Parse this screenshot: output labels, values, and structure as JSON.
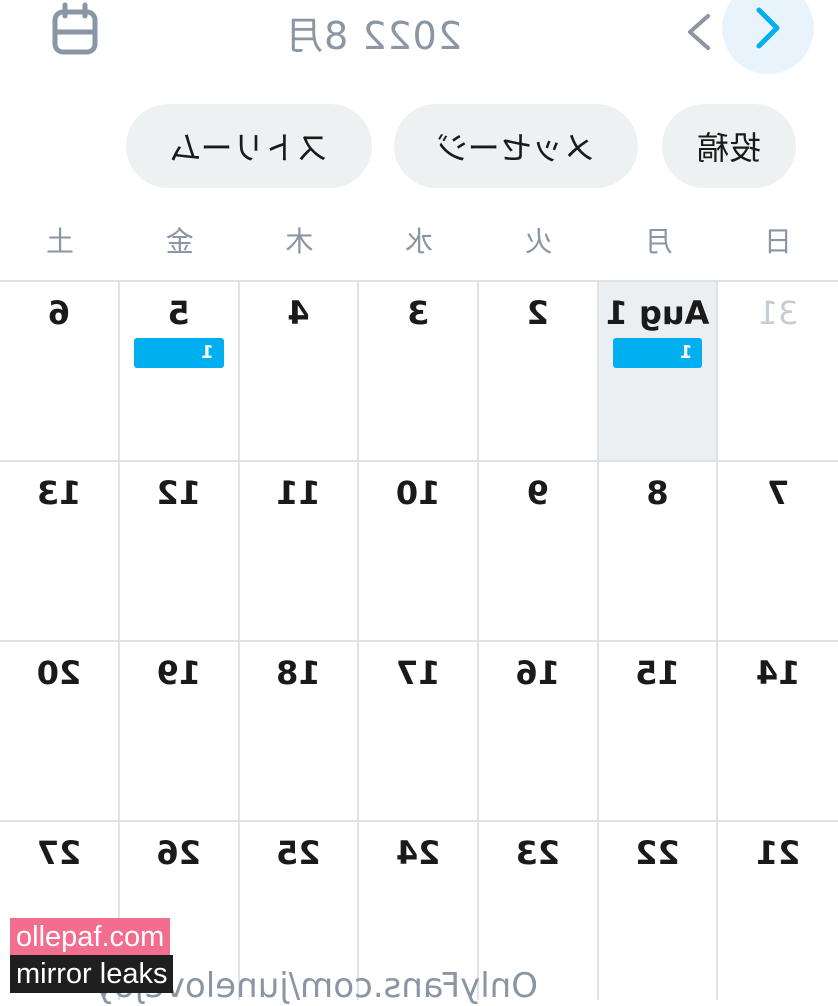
{
  "header": {
    "title": "2022 8月",
    "prev_icon": "chevron-left-icon",
    "next_icon": "chevron-right-icon",
    "calendar_icon": "calendar-icon",
    "accent_color": "#00aff0"
  },
  "chips": {
    "posts": "投稿",
    "messages": "メッセージ",
    "streams": "ストリーム"
  },
  "weekdays": [
    "日",
    "月",
    "火",
    "水",
    "木",
    "金",
    "土"
  ],
  "weeks": [
    [
      {
        "label": "31",
        "muted": true
      },
      {
        "label": "Aug 1",
        "today": true,
        "badge": "1"
      },
      {
        "label": "2"
      },
      {
        "label": "3"
      },
      {
        "label": "4"
      },
      {
        "label": "5",
        "badge": "1"
      },
      {
        "label": "6"
      }
    ],
    [
      {
        "label": "7"
      },
      {
        "label": "8"
      },
      {
        "label": "9"
      },
      {
        "label": "10"
      },
      {
        "label": "11"
      },
      {
        "label": "12"
      },
      {
        "label": "13"
      }
    ],
    [
      {
        "label": "14"
      },
      {
        "label": "15"
      },
      {
        "label": "16"
      },
      {
        "label": "17"
      },
      {
        "label": "18"
      },
      {
        "label": "19"
      },
      {
        "label": "20"
      }
    ],
    [
      {
        "label": "21"
      },
      {
        "label": "22"
      },
      {
        "label": "23"
      },
      {
        "label": "24"
      },
      {
        "label": "25"
      },
      {
        "label": "26"
      },
      {
        "label": "27"
      }
    ]
  ],
  "footer_text": "OnlyFans.com/junelovejoy",
  "watermark": {
    "line1": "ollepaf.com",
    "line2": "mirror leaks"
  }
}
